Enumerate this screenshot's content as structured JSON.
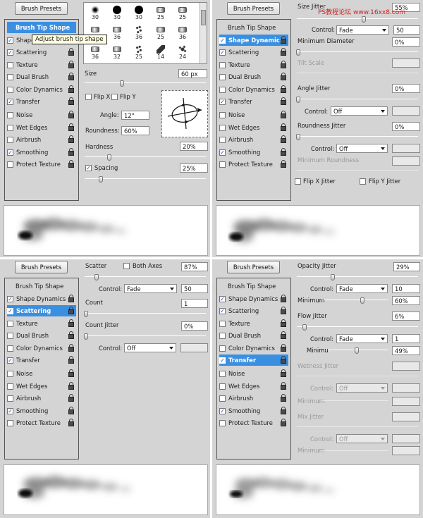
{
  "shared": {
    "presets_button": "Brush Presets",
    "list_items": [
      {
        "label": "Brush Tip Shape",
        "has_checkbox": false
      },
      {
        "label": "Shape Dynamics",
        "has_checkbox": true
      },
      {
        "label": "Scattering",
        "has_checkbox": true
      },
      {
        "label": "Texture",
        "has_checkbox": true
      },
      {
        "label": "Dual Brush",
        "has_checkbox": true
      },
      {
        "label": "Color Dynamics",
        "has_checkbox": true
      },
      {
        "label": "Transfer",
        "has_checkbox": true
      },
      {
        "label": "Noise",
        "has_checkbox": true
      },
      {
        "label": "Wet Edges",
        "has_checkbox": true
      },
      {
        "label": "Airbrush",
        "has_checkbox": true
      },
      {
        "label": "Smoothing",
        "has_checkbox": true
      },
      {
        "label": "Protect Texture",
        "has_checkbox": true
      }
    ],
    "check_mark": "✓"
  },
  "panel1": {
    "tooltip": "Adjust brush tip shape",
    "tip_sizes": [
      "30",
      "30",
      "30",
      "25",
      "25",
      "36",
      "36",
      "36",
      "25",
      "36",
      "36",
      "32",
      "25",
      "14",
      "24"
    ],
    "size_label": "Size",
    "size_value": "60 px",
    "flipx_label": "Flip X",
    "flipy_label": "Flip Y",
    "angle_label": "Angle:",
    "angle_value": "12°",
    "roundness_label": "Roundness:",
    "roundness_value": "60%",
    "hardness_label": "Hardness",
    "hardness_value": "20%",
    "hardness_level": 0.2,
    "spacing_label": "Spacing",
    "spacing_value": "25%",
    "spacing_level": 0.12,
    "size_level": 0.3
  },
  "panel2": {
    "size_jitter_label": "Size Jitter",
    "size_jitter_value": "55%",
    "size_jitter_level": 0.55,
    "control_label": "Control:",
    "control_value": "Fade",
    "fade_steps": "50",
    "min_diameter_label": "Minimum Diameter",
    "min_diameter_value": "0%",
    "tilt_scale_label": "Tilt Scale",
    "angle_jitter_label": "Angle Jitter",
    "angle_jitter_value": "0%",
    "angle_control_value": "Off",
    "roundness_jitter_label": "Roundness Jitter",
    "roundness_jitter_value": "0%",
    "roundness_control_value": "Off",
    "min_roundness_label": "Minimum Roundness",
    "flipx_jitter_label": "Flip X Jitter",
    "flipy_jitter_label": "Flip Y Jitter"
  },
  "panel3": {
    "scatter_label": "Scatter",
    "both_axes_label": "Both Axes",
    "scatter_value": "87%",
    "control_label": "Control:",
    "control_value": "Fade",
    "fade_steps": "50",
    "count_label": "Count",
    "count_value": "1",
    "count_jitter_label": "Count Jitter",
    "count_jitter_value": "0%",
    "control2_value": "Off"
  },
  "panel4": {
    "opacity_jitter_label": "Opacity Jitter",
    "opacity_jitter_value": "29%",
    "control_label": "Control:",
    "control_value": "Fade",
    "fade_steps": "10",
    "minimum_label": "Minimum",
    "minimum_value": "60%",
    "flow_jitter_label": "Flow Jitter",
    "flow_jitter_value": "6%",
    "flow_control_value": "Fade",
    "flow_fade_steps": "1",
    "flow_minimum_label": "Minimu",
    "flow_minimum_value": "49%",
    "wetness_jitter_label": "Wetness Jitter",
    "wetness_control_value": "Off",
    "mix_jitter_label": "Mix Jitter",
    "mix_control_value": "Off"
  },
  "watermark": "PS教程论坛 www.16xx8.com",
  "colors": {
    "selection": "#3b8fe0",
    "panel_bg": "#d4d4d4",
    "checkmark": "#1c4fb5"
  }
}
